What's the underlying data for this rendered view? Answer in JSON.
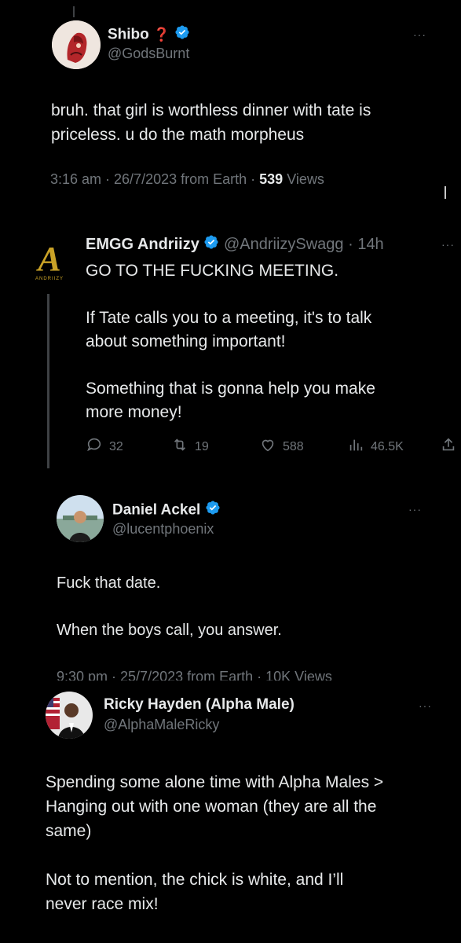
{
  "tweet1": {
    "name": "Shibo",
    "name_emoji": "❓",
    "handle": "@GodsBurnt",
    "text_line1": "bruh. that girl is worthless dinner with tate is",
    "text_line2": "priceless. u do the math morpheus",
    "meta_time": "3:16 am · 26/7/2023 from Earth · ",
    "views_count": "539",
    "views_label": " Views",
    "more": "···"
  },
  "quote": {
    "name": "EMGG Andriizy",
    "handle": "@AndriizySwagg · 14h",
    "more": "···",
    "logo_letter": "A",
    "logo_word": "ANDRIIZY",
    "line1": "GO TO THE FUCKING MEETING.",
    "para1_line1": "If Tate calls you to a meeting, it's to talk",
    "para1_line2": "about something important!",
    "para2_line1": "Something that is gonna help you make",
    "para2_line2": "more money!",
    "replies": "32",
    "retweets": "19",
    "likes": "588",
    "views": "46.5K"
  },
  "tweet3": {
    "name": "Daniel Ackel",
    "handle": "@lucentphoenix",
    "more": "···",
    "line1": "Fuck that date.",
    "line2": "When the boys call, you answer.",
    "meta": "9:30 pm · 25/7/2023 from Earth · 10K Views"
  },
  "tweet4": {
    "name": "Ricky Hayden (Alpha Male)",
    "handle": "@AlphaMaleRicky",
    "more": "···",
    "para1_line1": "Spending some alone time with Alpha Males >",
    "para1_line2": "Hanging out with one woman (they are all the",
    "para1_line3": "same)",
    "para2_line1": "Not to mention, the chick is white, and I’ll",
    "para2_line2": "never race mix!"
  },
  "colors": {
    "background": "#000000",
    "text": "#e7e9ea",
    "secondary": "#71767b",
    "verified": "#1d9bf0",
    "gold": "#c9a227"
  }
}
